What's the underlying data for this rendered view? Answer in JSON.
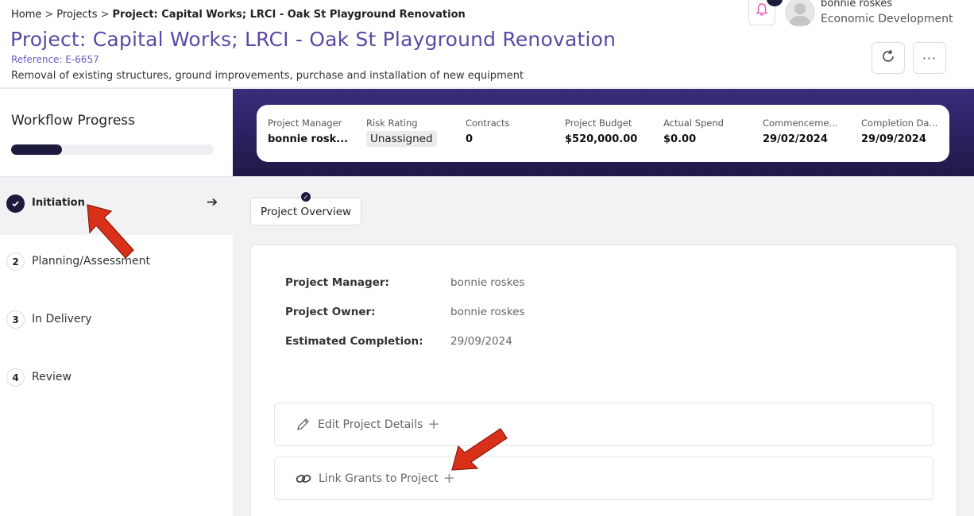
{
  "breadcrumb": {
    "home": "Home",
    "projects": "Projects",
    "current": "Project: Capital Works; LRCI - Oak St Playground Renovation",
    "separator": ">"
  },
  "header": {
    "title": "Project: Capital Works; LRCI - Oak St Playground Renovation",
    "reference": "Reference: E-6657",
    "description": "Removal of existing structures, ground improvements, purchase and installation of new equipment"
  },
  "user": {
    "name": "bonnie roskes",
    "department": "Economic Development"
  },
  "icons": {
    "bell": "bell-icon",
    "avatar": "avatar-icon",
    "refresh": "refresh-icon",
    "more": "more-icon"
  },
  "more_label": "···",
  "workflow": {
    "title": "Workflow Progress",
    "progress_fraction": 0.25,
    "steps": [
      {
        "number": "",
        "label": "Initiation",
        "done": true,
        "active": true
      },
      {
        "number": "2",
        "label": "Planning/Assessment"
      },
      {
        "number": "3",
        "label": "In Delivery"
      },
      {
        "number": "4",
        "label": "Review"
      }
    ]
  },
  "stats": [
    {
      "label": "Project Manager",
      "value": "bonnie rosk..."
    },
    {
      "label": "Risk Rating",
      "value": "Unassigned"
    },
    {
      "label": "Contracts",
      "value": "0"
    },
    {
      "label": "Project Budget",
      "value": "$520,000.00"
    },
    {
      "label": "Actual Spend",
      "value": "$0.00"
    },
    {
      "label": "Commenceme...",
      "value": "29/02/2024"
    },
    {
      "label": "Completion Da...",
      "value": "29/09/2024"
    }
  ],
  "tabs": {
    "overview": "Project Overview"
  },
  "overview": {
    "rows": [
      {
        "label": "Project Manager:",
        "value": "bonnie roskes"
      },
      {
        "label": "Project Owner:",
        "value": "bonnie roskes"
      },
      {
        "label": "Estimated Completion:",
        "value": "29/09/2024"
      }
    ],
    "actions": {
      "edit": "Edit Project Details",
      "link": "Link Grants to Project",
      "plus": "+"
    }
  },
  "colors": {
    "accent": "#5b4aa5",
    "dark": "#1c1a3d",
    "annotation": "#d9301a"
  }
}
